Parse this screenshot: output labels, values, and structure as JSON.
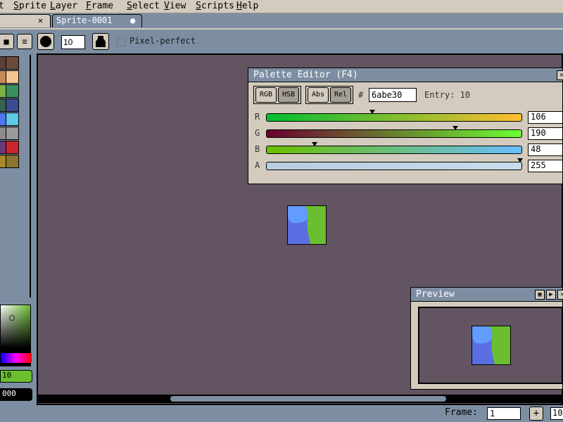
{
  "menubar": {
    "items": [
      {
        "label": "t",
        "underline": ""
      },
      {
        "label": "prite",
        "underline": "S"
      },
      {
        "label": "ayer",
        "underline": "L"
      },
      {
        "label": "rame",
        "underline": "F"
      },
      {
        "label": "elect",
        "underline": "S"
      },
      {
        "label": "iew",
        "underline": "V"
      },
      {
        "label": "cripts",
        "underline": "S"
      },
      {
        "label": "elp",
        "underline": "H"
      }
    ]
  },
  "tabs": [
    {
      "label": "",
      "close_glyph": "✕"
    },
    {
      "label": "Sprite-0001",
      "close_glyph": "●"
    }
  ],
  "context_bar": {
    "brush_size": "10",
    "pixel_perfect_label": "Pixel-perfect"
  },
  "palette": {
    "swatches": [
      [
        "#5a3e3a",
        "#6b4a3a"
      ],
      [
        "#c98a5a",
        "#f2c48e"
      ],
      [
        "#7cb342",
        "#3c8f5e"
      ],
      [
        "#35644c",
        "#3c4a90"
      ],
      [
        "#4d78f0",
        "#5ec8e8"
      ],
      [
        "#8c8c8c",
        "#9a9a9a"
      ],
      [
        "#6b3a7a",
        "#c8282d"
      ],
      [
        "#a88a2a",
        "#8a7430"
      ]
    ]
  },
  "color_picker": {
    "fg_value": "10",
    "bg_value": "000"
  },
  "palette_editor": {
    "title": "Palette Editor (F4)",
    "close_glyph": "✕",
    "mode_buttons": [
      "RGB",
      "HSB"
    ],
    "abs_rel_buttons": [
      "Abs",
      "Rel"
    ],
    "hash_label": "#",
    "hex_value": "6abe30",
    "entry_label": "Entry: 10",
    "channels": [
      {
        "label": "R",
        "value": "106",
        "fraction": 0.416
      },
      {
        "label": "G",
        "value": "190",
        "fraction": 0.745
      },
      {
        "label": "B",
        "value": "48",
        "fraction": 0.188
      },
      {
        "label": "A",
        "value": "255",
        "fraction": 1.0
      }
    ]
  },
  "preview": {
    "title": "Preview",
    "icons": [
      "maximize-icon",
      "play-icon",
      "close-icon"
    ],
    "icon_glyphs": [
      "▣",
      "▶",
      "✕"
    ]
  },
  "status_bar": {
    "frame_label": "Frame:",
    "frame_value": "1",
    "add_glyph": "+",
    "zoom_value": "10"
  },
  "colors": {
    "workspace": "#625460",
    "panel": "#7d8ea3",
    "menu": "#d3cbbd",
    "sprite_blue": "#5b6ee1",
    "sprite_green": "#6abe30"
  }
}
